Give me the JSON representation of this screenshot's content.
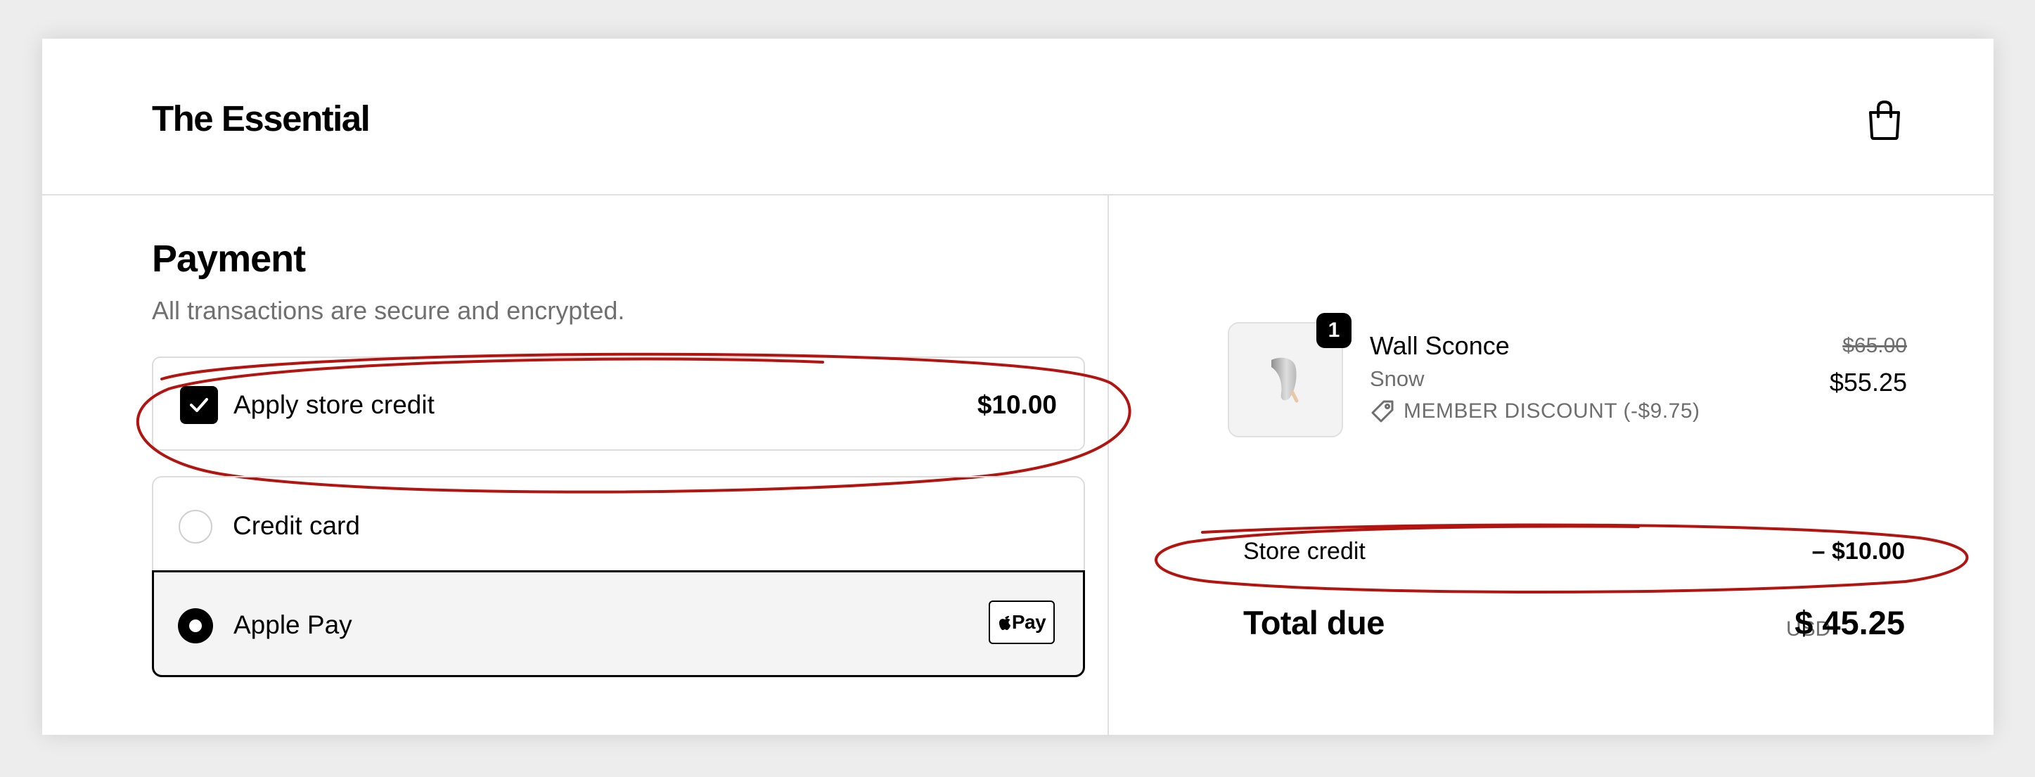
{
  "header": {
    "brand": "The Essential",
    "bag_icon": "shopping-bag-icon"
  },
  "payment": {
    "title": "Payment",
    "subtitle": "All transactions are secure and encrypted.",
    "store_credit": {
      "label": "Apply store credit",
      "amount": "$10.00",
      "checked": true
    },
    "methods": [
      {
        "label": "Credit card",
        "selected": false
      },
      {
        "label": "Apple Pay",
        "selected": true,
        "badge": "Pay"
      }
    ]
  },
  "summary": {
    "item": {
      "quantity": "1",
      "name": "Wall Sconce",
      "variant": "Snow",
      "discount": "MEMBER DISCOUNT (-$9.75)",
      "original_price": "$65.00",
      "price": "$55.25"
    },
    "store_credit": {
      "label": "Store credit",
      "amount": "– $10.00"
    },
    "total": {
      "label": "Total due",
      "currency": "USD",
      "amount": "$ 45.25"
    }
  },
  "colors": {
    "annotation": "#b3140f",
    "accent": "#000000",
    "muted_text": "#6e6e6e",
    "border": "#dcdcdc"
  }
}
